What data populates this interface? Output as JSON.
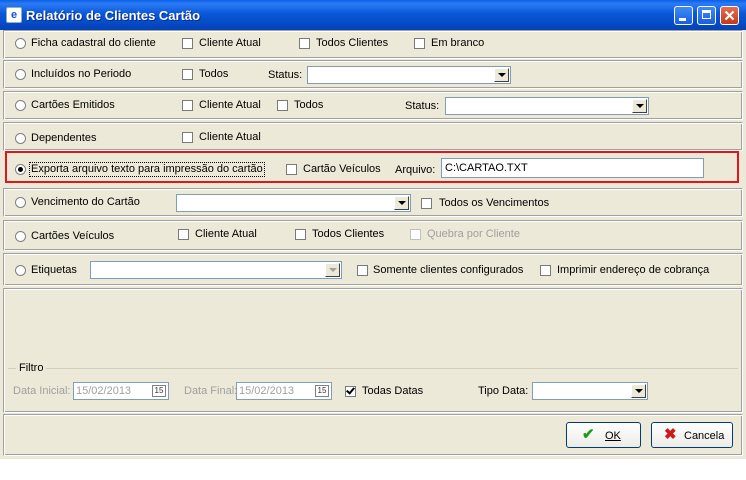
{
  "window": {
    "title": "Relatório de Clientes Cartão",
    "app_icon": "e"
  },
  "rows": {
    "ficha": {
      "label": "Ficha cadastral do cliente",
      "cliente_atual": "Cliente Atual",
      "todos_clientes": "Todos Clientes",
      "em_branco": "Em branco"
    },
    "incluidos": {
      "label": "Incluídos no Periodo",
      "todos": "Todos",
      "status_label": "Status:",
      "status_value": ""
    },
    "emitidos": {
      "label": "Cartões Emitidos",
      "cliente_atual": "Cliente Atual",
      "todos": "Todos",
      "status_label": "Status:",
      "status_value": ""
    },
    "dependentes": {
      "label": "Dependentes",
      "cliente_atual": "Cliente Atual"
    },
    "exporta": {
      "label": "Exporta arquivo texto para impressão do cartão",
      "cartao_veiculos": "Cartão Veículos",
      "arquivo_label": "Arquivo:",
      "arquivo_value": "C:\\CARTAO.TXT"
    },
    "vencimento": {
      "label": "Vencimento do Cartão",
      "combo_value": "",
      "todos_vencimentos": "Todos os Vencimentos"
    },
    "veiculos": {
      "label": "Cartões Veículos",
      "cliente_atual": "Cliente Atual",
      "todos_clientes": "Todos Clientes",
      "quebra": "Quebra por Cliente"
    },
    "etiquetas": {
      "label": "Etiquetas",
      "combo_value": "",
      "somente": "Somente clientes configurados",
      "imprimir": "Imprimir endereço de cobrança"
    }
  },
  "filtro": {
    "legend": "Filtro",
    "data_inicial_label": "Data Inicial:",
    "data_inicial_value": "15/02/2013",
    "data_final_label": "Data Final:",
    "data_final_value": "15/02/2013",
    "calendar_glyph": "15",
    "todas_datas": "Todas Datas",
    "tipo_data_label": "Tipo Data:",
    "tipo_data_value": ""
  },
  "buttons": {
    "ok_prefix": "",
    "ok_label": "OK",
    "cancel_label": "Cancela"
  },
  "colors": {
    "highlight_border": "#e3151a",
    "ok_icon": "#1f9c1f",
    "cancel_icon": "#cc1a1a"
  }
}
